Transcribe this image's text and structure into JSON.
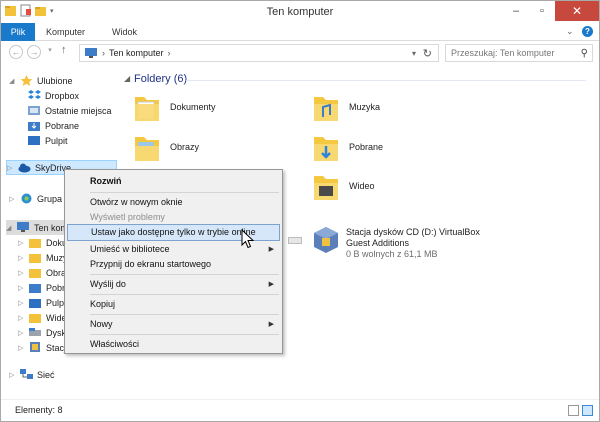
{
  "window": {
    "title": "Ten komputer"
  },
  "ribbon": {
    "tabs": [
      "Plik",
      "Komputer",
      "Widok"
    ]
  },
  "address": {
    "path": "Ten komputer",
    "search_placeholder": "Przeszukaj: Ten komputer"
  },
  "nav": {
    "favorites_label": "Ulubione",
    "favorites": [
      "Dropbox",
      "Ostatnie miejsca",
      "Pobrane",
      "Pulpit"
    ],
    "skydrive": "SkyDrive",
    "homegroup": "Grupa d",
    "computer": "Ten kom",
    "computer_children": [
      "Doku",
      "Muzy",
      "Obraz",
      "Pobra",
      "Pulpit",
      "Wideo",
      "Dysk l",
      "Stacja"
    ],
    "network": "Sieć"
  },
  "content": {
    "folders_header": "Foldery (6)",
    "folders": [
      "Dokumenty",
      "Muzyka",
      "Obrazy",
      "Pobrane",
      "Wideo"
    ],
    "drive": {
      "name": "Stacja dysków CD (D:) VirtualBox",
      "name2": "Guest Additions",
      "free": "0 B wolnych z 61,1 MB"
    }
  },
  "context_menu": {
    "items": [
      "Rozwiń",
      "Otwórz w nowym oknie",
      "Wyświetl problemy",
      "Ustaw jako dostępne tylko w trybie online",
      "Umieść w bibliotece",
      "Przypnij do ekranu startowego",
      "Wyślij do",
      "Kopiuj",
      "Nowy",
      "Właściwości"
    ]
  },
  "status": {
    "count": "Elementy: 8"
  },
  "colors": {
    "accent": "#1979ca",
    "folder": "#f5c842",
    "selection": "#cde8ff"
  }
}
